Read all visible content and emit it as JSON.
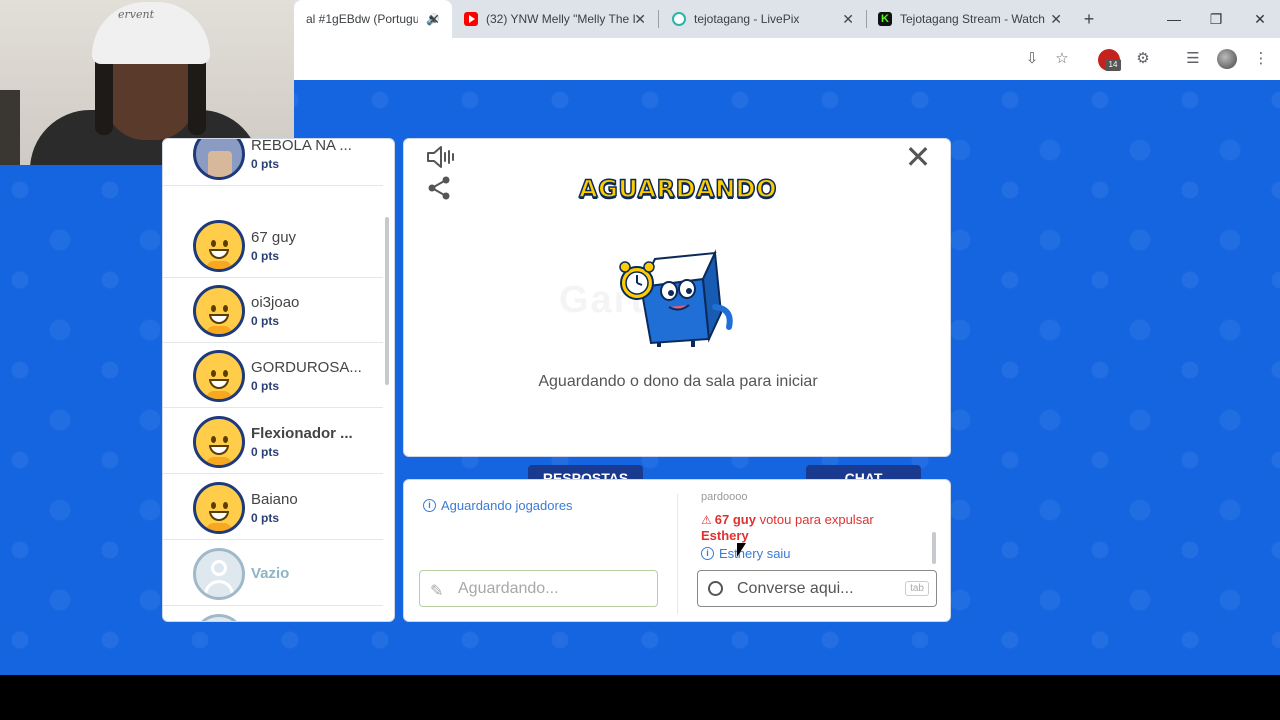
{
  "browser": {
    "tabs": [
      {
        "title": "al #1gEBdw (Portugu",
        "favicon": "gartic-icon",
        "active": true
      },
      {
        "title": "(32) YNW Melly \"Melly The I",
        "favicon": "youtube-icon",
        "active": false
      },
      {
        "title": "tejotagang - LivePix",
        "favicon": "livepix-icon",
        "active": false
      },
      {
        "title": "Tejotagang Stream - Watch",
        "favicon": "kick-icon",
        "active": false
      }
    ],
    "extension_badge": "14"
  },
  "webcam": {
    "cap_text": "ervent"
  },
  "players": [
    {
      "name": "REBOLA NA ...",
      "points": "0 pts",
      "avatar": "photo"
    },
    {
      "name": "67 guy",
      "points": "0 pts",
      "avatar": "smiley"
    },
    {
      "name": "oi3joao",
      "points": "0 pts",
      "avatar": "smiley"
    },
    {
      "name": "GORDUROSA...",
      "points": "0 pts",
      "avatar": "smiley"
    },
    {
      "name": "Flexionador ...",
      "points": "0 pts",
      "avatar": "smiley"
    },
    {
      "name": "Baiano",
      "points": "0 pts",
      "avatar": "smiley"
    },
    {
      "name": "Vazio",
      "points": "",
      "avatar": "empty"
    }
  ],
  "main": {
    "title": "AGUARDANDO",
    "message": "Aguardando o dono da sala para iniciar",
    "watermark": "Gartic"
  },
  "tabs": {
    "answers": "RESPOSTAS",
    "chat": "CHAT"
  },
  "answers": {
    "info": "Aguardando jogadores",
    "input_placeholder": "Aguardando..."
  },
  "chat": {
    "old_message": "pardoooo",
    "vote_user": "67 guy",
    "vote_text": " votou para expulsar ",
    "vote_target": "Esthery",
    "left_user": "Esthery",
    "left_text": " saiu",
    "input_placeholder": "Converse aqui...",
    "tab_key": "tab"
  },
  "colors": {
    "background": "#1565e0",
    "title_yellow": "#ffcc00",
    "tab_navy": "#1a3a8f",
    "warning_red": "#e03131",
    "info_blue": "#3a7bd5"
  }
}
